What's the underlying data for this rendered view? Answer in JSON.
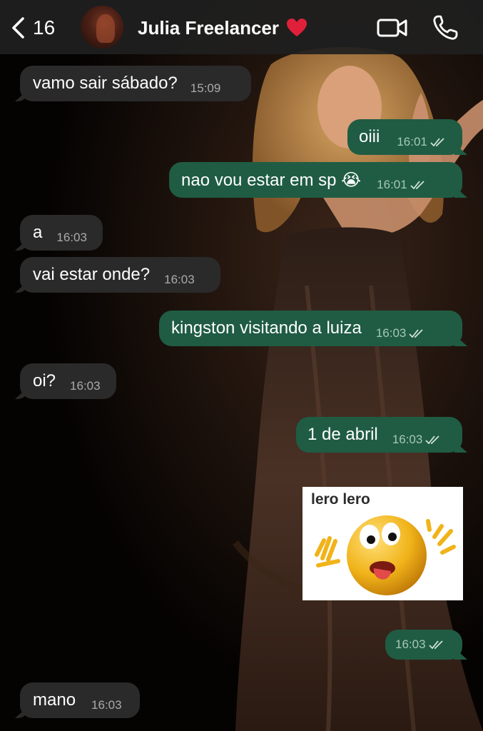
{
  "header": {
    "back_count": "16",
    "contact_name": "Julia Freelancer",
    "icons": {
      "back": "chevron-left-icon",
      "video": "video-camera-icon",
      "call": "phone-icon",
      "heart": "red-heart-emoji"
    }
  },
  "messages": [
    {
      "direction": "in",
      "text": "vamo sair sábado?",
      "time": "15:09"
    },
    {
      "direction": "out",
      "text": "oiii",
      "time": "16:01",
      "read": true
    },
    {
      "direction": "out",
      "text": "nao vou estar em sp 😭",
      "time": "16:01",
      "read": true
    },
    {
      "direction": "in",
      "text": "a",
      "time": "16:03"
    },
    {
      "direction": "in",
      "text": "vai estar onde?",
      "time": "16:03"
    },
    {
      "direction": "out",
      "text": "kingston visitando a luiza",
      "time": "16:03",
      "read": true
    },
    {
      "direction": "in",
      "text": "oi?",
      "time": "16:03"
    },
    {
      "direction": "out",
      "text": "1 de abril",
      "time": "16:03",
      "read": true
    },
    {
      "direction": "out",
      "type": "sticker",
      "caption": "lero lero"
    },
    {
      "direction": "out",
      "text": "",
      "time": "16:03",
      "read": true
    },
    {
      "direction": "in",
      "text": "mano",
      "time": "16:03"
    }
  ],
  "colors": {
    "incoming_bubble": "#2a2a2a",
    "outgoing_bubble": "#1f5c43",
    "header_bg": "#202020"
  }
}
